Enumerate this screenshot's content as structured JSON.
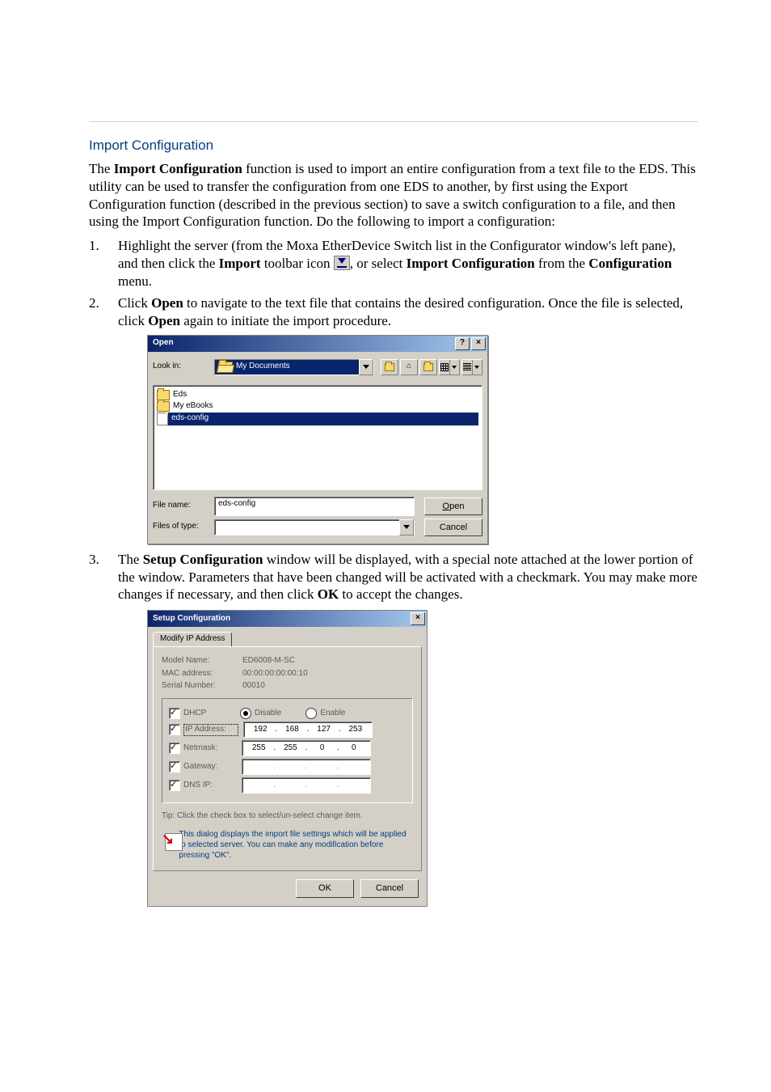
{
  "section_title": "Import Configuration",
  "intro": {
    "p1_a": "The ",
    "p1_bold": "Import Configuration",
    "p1_b": " function is used to import an entire configuration from a text file to the EDS. This utility can be used to transfer the configuration from one EDS to another, by first using the Export Configuration function (described in the previous section) to save a switch configuration to a file, and then using the Import Configuration function. Do the following to import a configuration:"
  },
  "steps": {
    "s1_a": "Highlight the server (from the Moxa EtherDevice Switch list in the Configurator window's left pane), and then click the ",
    "s1_bold1": "Import",
    "s1_b": " toolbar icon ",
    "s1_c": ", or select ",
    "s1_bold2": "Import Configuration",
    "s1_d": " from the ",
    "s1_bold3": "Configuration",
    "s1_e": " menu.",
    "s2_a": "Click ",
    "s2_bold1": "Open",
    "s2_b": " to navigate to the text file that contains the desired configuration. Once the file is selected, click ",
    "s2_bold2": "Open",
    "s2_c": " again to initiate the import procedure.",
    "s3_a": "The ",
    "s3_bold1": "Setup Configuration",
    "s3_b": " window will be displayed, with a special note attached at the lower portion of the window. Parameters that have been changed will be activated with a checkmark. You may make more changes if necessary, and then click ",
    "s3_bold2": "OK",
    "s3_c": " to accept the changes."
  },
  "open_dialog": {
    "title": "Open",
    "help_btn": "?",
    "close_btn": "×",
    "lookin_label": "Look in:",
    "lookin_value": "My Documents",
    "file_list": {
      "f1": "Eds",
      "f2": "My eBooks",
      "f3": "eds-config"
    },
    "filename_label": "File name:",
    "filename_value": "eds-config",
    "filetype_label": "Files of type:",
    "filetype_value": "",
    "open_btn": "Open",
    "cancel_btn": "Cancel"
  },
  "setup_dialog": {
    "title": "Setup Configuration",
    "close_btn": "×",
    "tab": "Modify IP Address",
    "model_k": "Model Name:",
    "model_v": "ED6008-M-SC",
    "mac_k": "MAC address:",
    "mac_v": "00:00:00:00:00:10",
    "serial_k": "Serial Number:",
    "serial_v": "00010",
    "dhcp_label": "DHCP",
    "disable": "Disable",
    "enable": "Enable",
    "ip_label": "IP Address:",
    "ip_v": {
      "a": "192",
      "b": "168",
      "c": "127",
      "d": "253"
    },
    "nm_label": "Netmask:",
    "nm_v": {
      "a": "255",
      "b": "255",
      "c": "0",
      "d": "0"
    },
    "gw_label": "Gateway:",
    "gw_v": {
      "a": "",
      "b": "",
      "c": "",
      "d": ""
    },
    "dns_label": "DNS IP:",
    "dns_v": {
      "a": "",
      "b": "",
      "c": "",
      "d": ""
    },
    "tip": "Tip: Click the check box to select/un-select change item.",
    "note": "This dialog displays the import file settings which will be applied to selected server. You can make any modification before pressing \"OK\".",
    "ok_btn": "OK",
    "cancel_btn": "Cancel"
  }
}
